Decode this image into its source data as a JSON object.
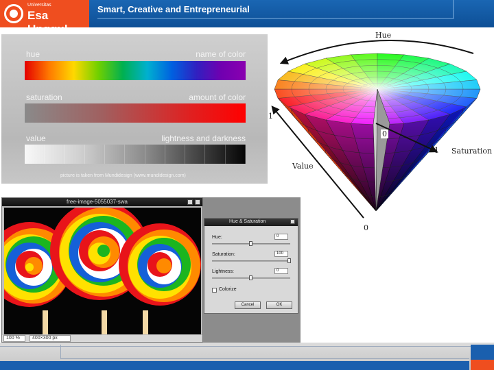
{
  "header": {
    "logo_small": "Universitas",
    "logo_text": "Esa Unggul",
    "tagline": "Smart, Creative and Entrepreneurial"
  },
  "color_properties": {
    "hue_label": "hue",
    "hue_desc": "name of color",
    "saturation_label": "saturation",
    "saturation_desc": "amount of color",
    "value_label": "value",
    "value_desc": "lightness and darkness",
    "credit": "picture is taken from Mundidesign (www.mundidesign.com)"
  },
  "cone": {
    "hue_label": "Hue",
    "value_label": "Value",
    "saturation_label": "Saturation",
    "value_top": "1",
    "value_bottom": "0",
    "sat_zero": "0",
    "sat_one": "1"
  },
  "photo_window": {
    "title": "free-image-5055037-swa",
    "zoom": "100 %",
    "size": "400×300 px"
  },
  "dialog": {
    "title": "Hue & Saturation",
    "hue_label": "Hue:",
    "hue_value": "0",
    "saturation_label": "Saturation:",
    "saturation_value": "100",
    "lightness_label": "Lightness:",
    "lightness_value": "0",
    "colorize_label": "Colorize",
    "cancel_label": "Cancel",
    "ok_label": "OK"
  },
  "colors": {
    "brand_orange": "#ef4e1f",
    "brand_blue": "#1a5fae"
  }
}
